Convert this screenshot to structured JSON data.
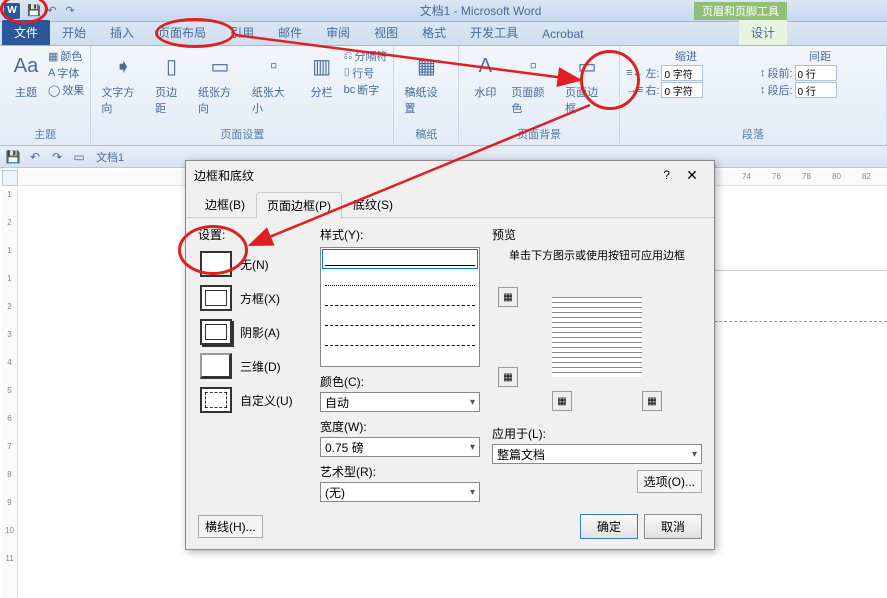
{
  "titlebar": {
    "title": "文档1 - Microsoft Word",
    "contextual": "页眉和页脚工具"
  },
  "tabs": {
    "file": "文件",
    "home": "开始",
    "insert": "插入",
    "layout": "页面布局",
    "ref": "引用",
    "mail": "邮件",
    "review": "审阅",
    "view": "视图",
    "format": "格式",
    "dev": "开发工具",
    "acrobat": "Acrobat",
    "design": "设计"
  },
  "ribbon": {
    "themes": {
      "label": "主题",
      "theme": "主题",
      "colors": "颜色",
      "fonts": "字体",
      "effects": "效果"
    },
    "page_setup": {
      "label": "页面设置",
      "text_dir": "文字方向",
      "margins": "页边距",
      "orient": "纸张方向",
      "size": "纸张大小",
      "columns": "分栏",
      "breaks": "分隔符",
      "line_num": "行号",
      "hyphen": "断字"
    },
    "paper": {
      "label": "稿纸",
      "grid": "稿纸设置"
    },
    "background": {
      "label": "页面背景",
      "watermark": "水印",
      "color": "页面颜色",
      "border": "页面边框"
    },
    "paragraph": {
      "label": "段落",
      "indent": "缩进",
      "spacing": "间距",
      "left_label": "左:",
      "left_val": "0 字符",
      "right_label": "右:",
      "right_val": "0 字符",
      "before_label": "段前:",
      "before_val": "0 行",
      "after_label": "段后:",
      "after_val": "0 行"
    }
  },
  "quickbar": {
    "doc": "文档1"
  },
  "ruler_h": [
    "74",
    "76",
    "78",
    "80",
    "82"
  ],
  "ruler_v": [
    "1",
    "2",
    "1",
    "1",
    "2",
    "3",
    "4",
    "5",
    "6",
    "7",
    "8",
    "9",
    "10",
    "11"
  ],
  "dialog": {
    "title": "边框和底纹",
    "tabs": {
      "border": "边框(B)",
      "page_border": "页面边框(P)",
      "shading": "底纹(S)"
    },
    "setting_label": "设置:",
    "settings": {
      "none": "无(N)",
      "box": "方框(X)",
      "shadow": "阴影(A)",
      "threed": "三维(D)",
      "custom": "自定义(U)"
    },
    "style_label": "样式(Y):",
    "color_label": "颜色(C):",
    "color_val": "自动",
    "width_label": "宽度(W):",
    "width_val": "0.75 磅",
    "art_label": "艺术型(R):",
    "art_val": "(无)",
    "preview_label": "预览",
    "preview_hint": "单击下方图示或使用按钮可应用边框",
    "apply_label": "应用于(L):",
    "apply_val": "整篇文档",
    "options": "选项(O)...",
    "hline": "横线(H)...",
    "ok": "确定",
    "cancel": "取消"
  }
}
